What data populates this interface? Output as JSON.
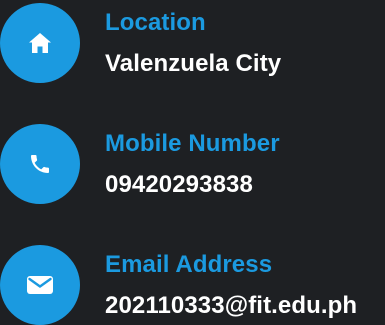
{
  "theme": {
    "background": "#1e2023",
    "accent": "#1b9ae0",
    "value_color": "#ffffff"
  },
  "contacts": [
    {
      "icon": "home-icon",
      "label": "Location",
      "value": "Valenzuela City"
    },
    {
      "icon": "phone-icon",
      "label": "Mobile Number",
      "value": "09420293838"
    },
    {
      "icon": "envelope-icon",
      "label": "Email Address",
      "value": "202110333@fit.edu.ph"
    }
  ]
}
